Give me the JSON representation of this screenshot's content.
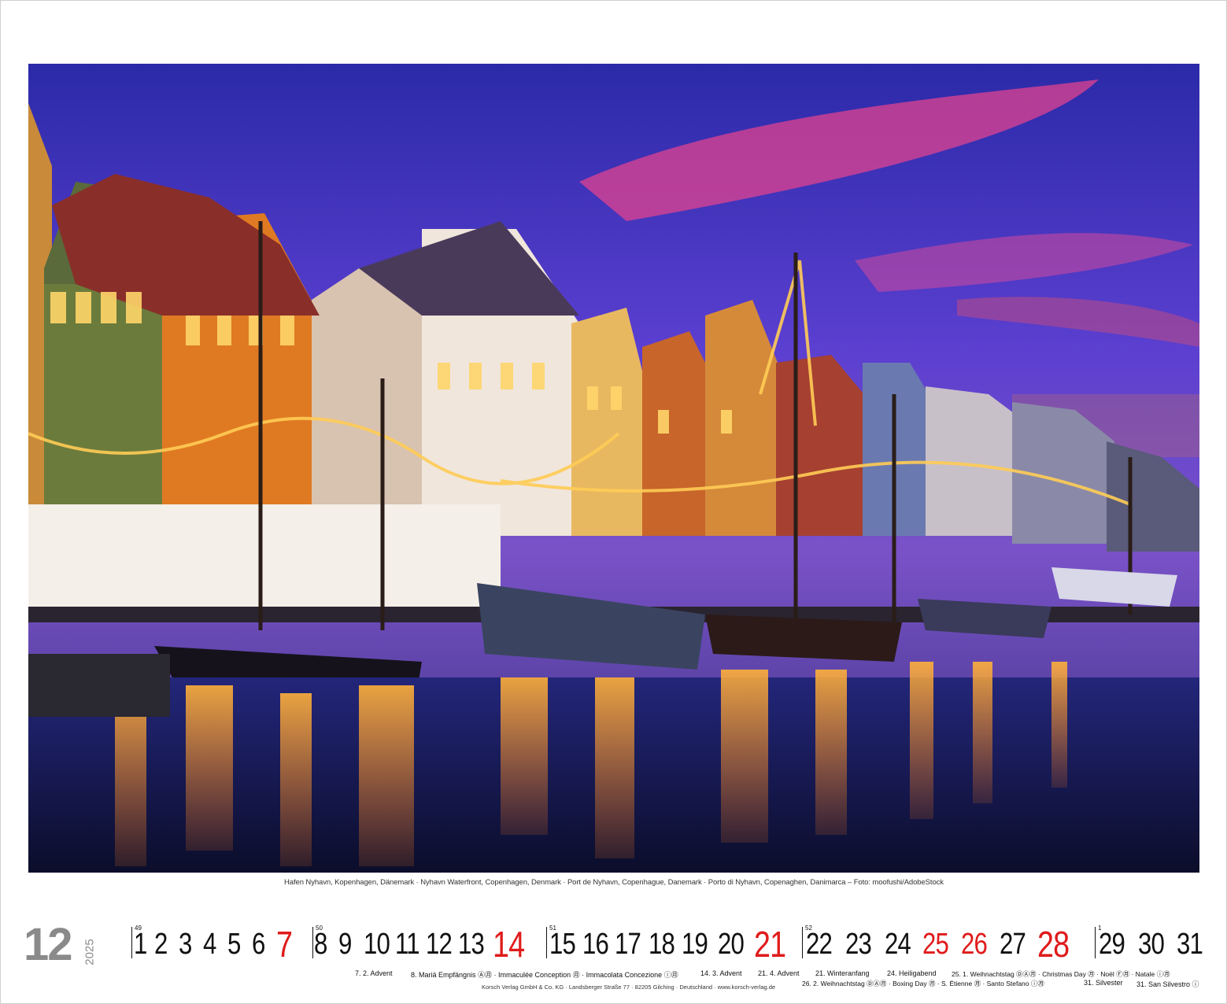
{
  "photo": {
    "subject": "Nyhavn harbour at dusk with illuminated boats and colorful houses",
    "colors": {
      "sky_top": "#3a2fb8",
      "sky_mid": "#6a3fd6",
      "cloud_pink": "#e3408f",
      "water": "#1b1f6e",
      "lights": "#ffb84a"
    }
  },
  "caption": "Hafen Nyhavn, Kopenhagen, Dänemark · Nyhavn Waterfront, Copenhagen, Denmark · Port de Nyhavn, Copenhague, Danemark · Porto di Nyhavn, Copenaghen, Danimarca – Foto: moofushi/AdobeStock",
  "month": "12",
  "year": "2025",
  "weeks": [
    "49",
    "50",
    "51",
    "52",
    "1"
  ],
  "days": [
    {
      "n": "1",
      "red": false
    },
    {
      "n": "2",
      "red": false
    },
    {
      "n": "3",
      "red": false
    },
    {
      "n": "4",
      "red": false
    },
    {
      "n": "5",
      "red": false
    },
    {
      "n": "6",
      "red": false
    },
    {
      "n": "7",
      "red": true,
      "sunday": true
    },
    {
      "n": "8",
      "red": false
    },
    {
      "n": "9",
      "red": false
    },
    {
      "n": "10",
      "red": false
    },
    {
      "n": "11",
      "red": false
    },
    {
      "n": "12",
      "red": false
    },
    {
      "n": "13",
      "red": false
    },
    {
      "n": "14",
      "red": true,
      "sunday": true
    },
    {
      "n": "15",
      "red": false
    },
    {
      "n": "16",
      "red": false
    },
    {
      "n": "17",
      "red": false
    },
    {
      "n": "18",
      "red": false
    },
    {
      "n": "19",
      "red": false
    },
    {
      "n": "20",
      "red": false
    },
    {
      "n": "21",
      "red": true,
      "sunday": true
    },
    {
      "n": "22",
      "red": false
    },
    {
      "n": "23",
      "red": false
    },
    {
      "n": "24",
      "red": false
    },
    {
      "n": "25",
      "red": true
    },
    {
      "n": "26",
      "red": true
    },
    {
      "n": "27",
      "red": false
    },
    {
      "n": "28",
      "red": true,
      "sunday": true
    },
    {
      "n": "29",
      "red": false
    },
    {
      "n": "30",
      "red": false
    },
    {
      "n": "31",
      "red": false
    }
  ],
  "holidays_row1": [
    "7. 2. Advent",
    "8. Mariä Empfängnis Ⓐ㊊ · Immaculée Conception ㊊ · Immacolata Concezione ⓘ㊊",
    "14. 3. Advent",
    "21. 4. Advent",
    "21. Winteranfang",
    "24. Heiligabend",
    "25. 1. Weihnachtstag ⒹⒶ㊊ · Christmas Day ㊊ · Noël Ⓕ㊊ · Natale ⓘ㊊"
  ],
  "holidays_row2": [
    "26. 2. Weihnachtstag ⒹⒶ㊊ · Boxing Day ㊊ · S. Étienne ㊊ · Santo Stefano ⓘ㊊",
    "31. Silvester",
    "31. San Silvestro ⓘ"
  ],
  "publisher": "Korsch Verlag GmbH & Co. KG · Landsberger Straße 77 · 82205 Gilching · Deutschland · www.korsch-verlag.de"
}
